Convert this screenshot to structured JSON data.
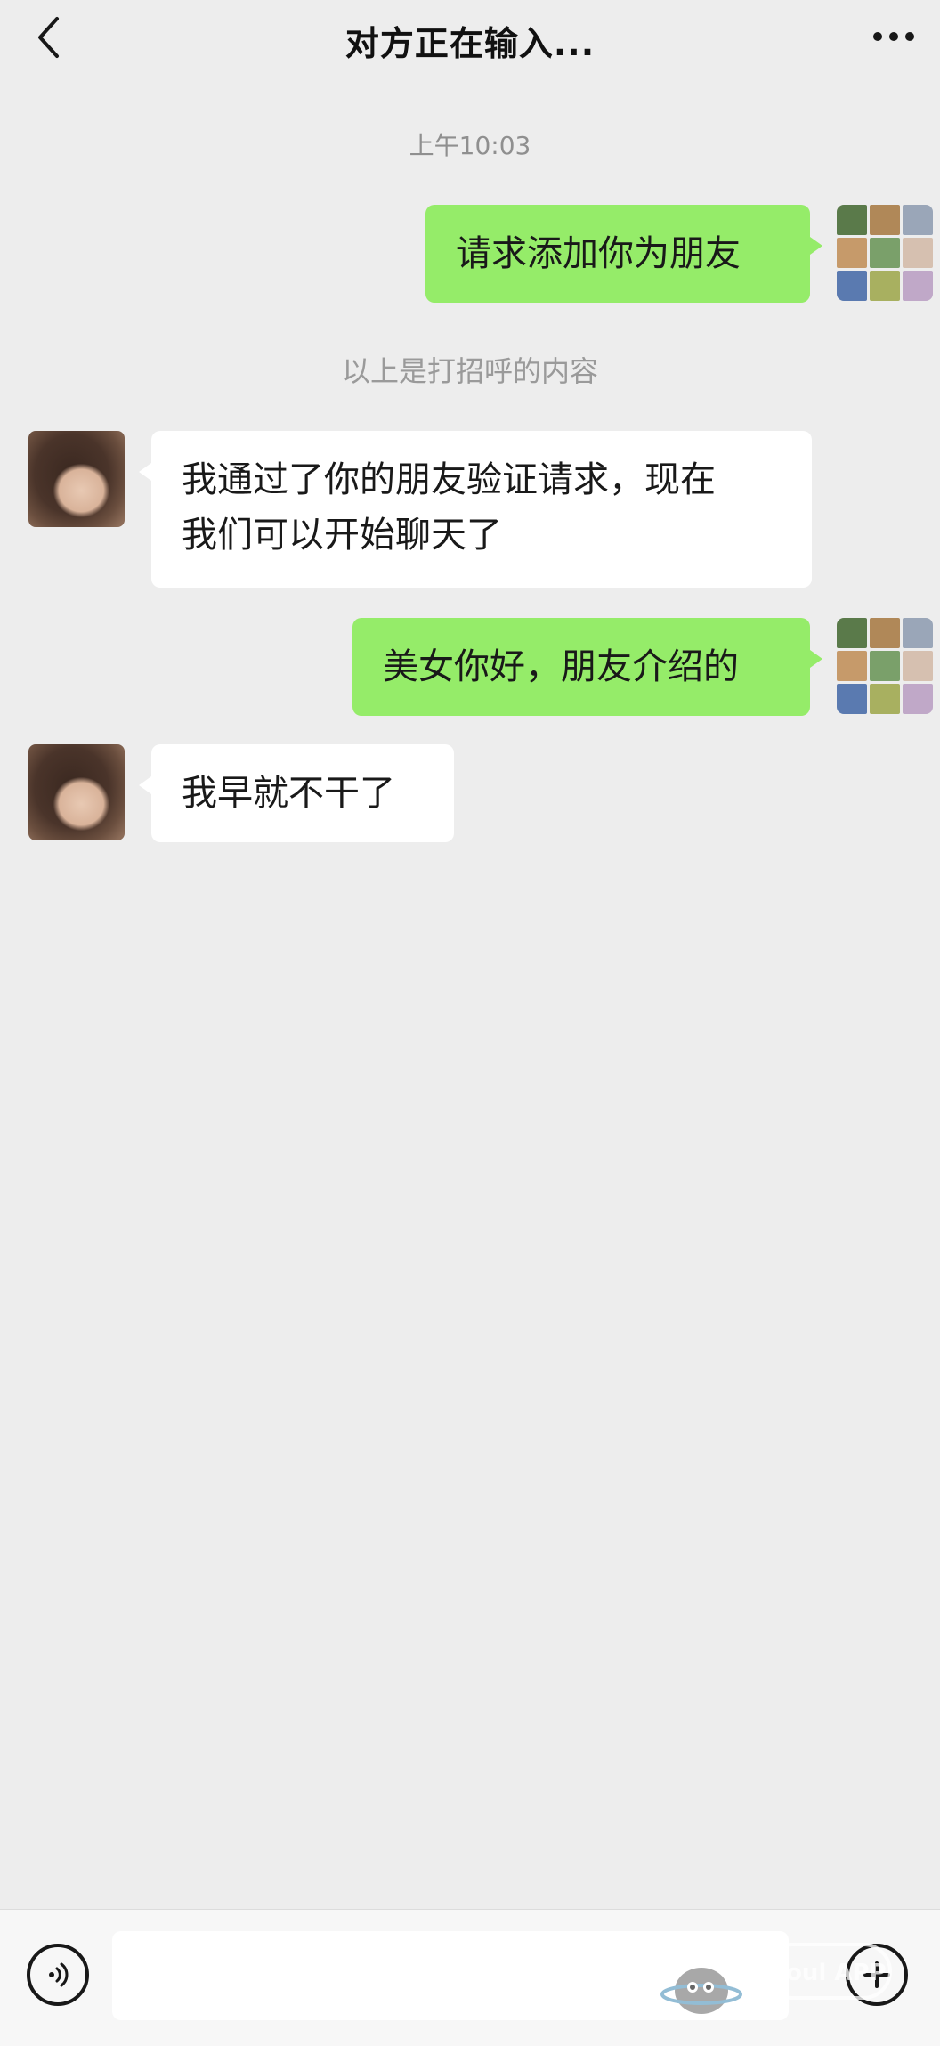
{
  "header": {
    "title": "对方正在输入...",
    "back_icon": "chevron-left-icon",
    "more_icon": "ellipsis-icon"
  },
  "chat": {
    "timestamp": "上午10:03",
    "system_note": "以上是打招呼的内容",
    "messages": [
      {
        "from": "me",
        "lines": [
          "请求添加你为朋友"
        ]
      },
      {
        "from": "contact",
        "lines": [
          "我通过了你的朋友验证请求，现在",
          "我们可以开始聊天了"
        ]
      },
      {
        "from": "me",
        "lines": [
          "美女你好，朋友介绍的"
        ]
      },
      {
        "from": "contact",
        "lines": [
          "我早就不干了"
        ]
      }
    ]
  },
  "input_bar": {
    "voice_icon": "voice-icon",
    "plus_icon": "plus-icon",
    "input_value": ""
  },
  "watermark": {
    "text": "Soul APP"
  },
  "colors": {
    "background": "#ededed",
    "my_bubble": "#95ec69",
    "contact_bubble": "#ffffff",
    "title_text": "#111111",
    "meta_text": "#9a9a9a"
  }
}
